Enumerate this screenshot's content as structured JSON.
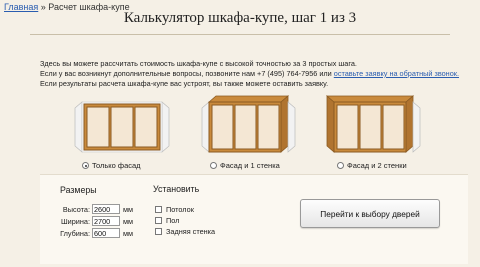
{
  "breadcrumb": {
    "home": "Главная",
    "separator": " » ",
    "current": "Расчет шкафа-купе"
  },
  "title": "Калькулятор шкафа-купе, шаг 1 из 3",
  "intro": {
    "line1": "Здесь вы можете рассчитать стоимость шкафа-купе с высокой точностью за 3 простых шага.",
    "line2_prefix": "Если у вас возникнут дополнительные вопросы, позвоните нам +7 (495) 764-7956 или ",
    "line2_link": "оставьте заявку на обратный звонок.",
    "line3": "Если результаты расчета шкафа-купе вас устроят, вы также можете оставить заявку."
  },
  "options": [
    {
      "label": "Только фасад",
      "selected": true
    },
    {
      "label": "Фасад и 1 стенка",
      "selected": false
    },
    {
      "label": "Фасад и 2 стенки",
      "selected": false
    }
  ],
  "sizes": {
    "title": "Размеры",
    "height_label": "Высота:",
    "height_value": "2600",
    "width_label": "Ширина:",
    "width_value": "2700",
    "depth_label": "Глубина:",
    "depth_value": "600",
    "unit": "мм"
  },
  "install": {
    "title": "Установить",
    "items": [
      "Потолок",
      "Пол",
      "Задняя стенка"
    ]
  },
  "go_button": "Перейти к выбору дверей",
  "colors": {
    "wood": "#c98a3c",
    "wood_dark": "#8a5a22",
    "mirror": "#f4e7d4",
    "wall": "#f2f2f2",
    "link": "#2a5db0"
  }
}
